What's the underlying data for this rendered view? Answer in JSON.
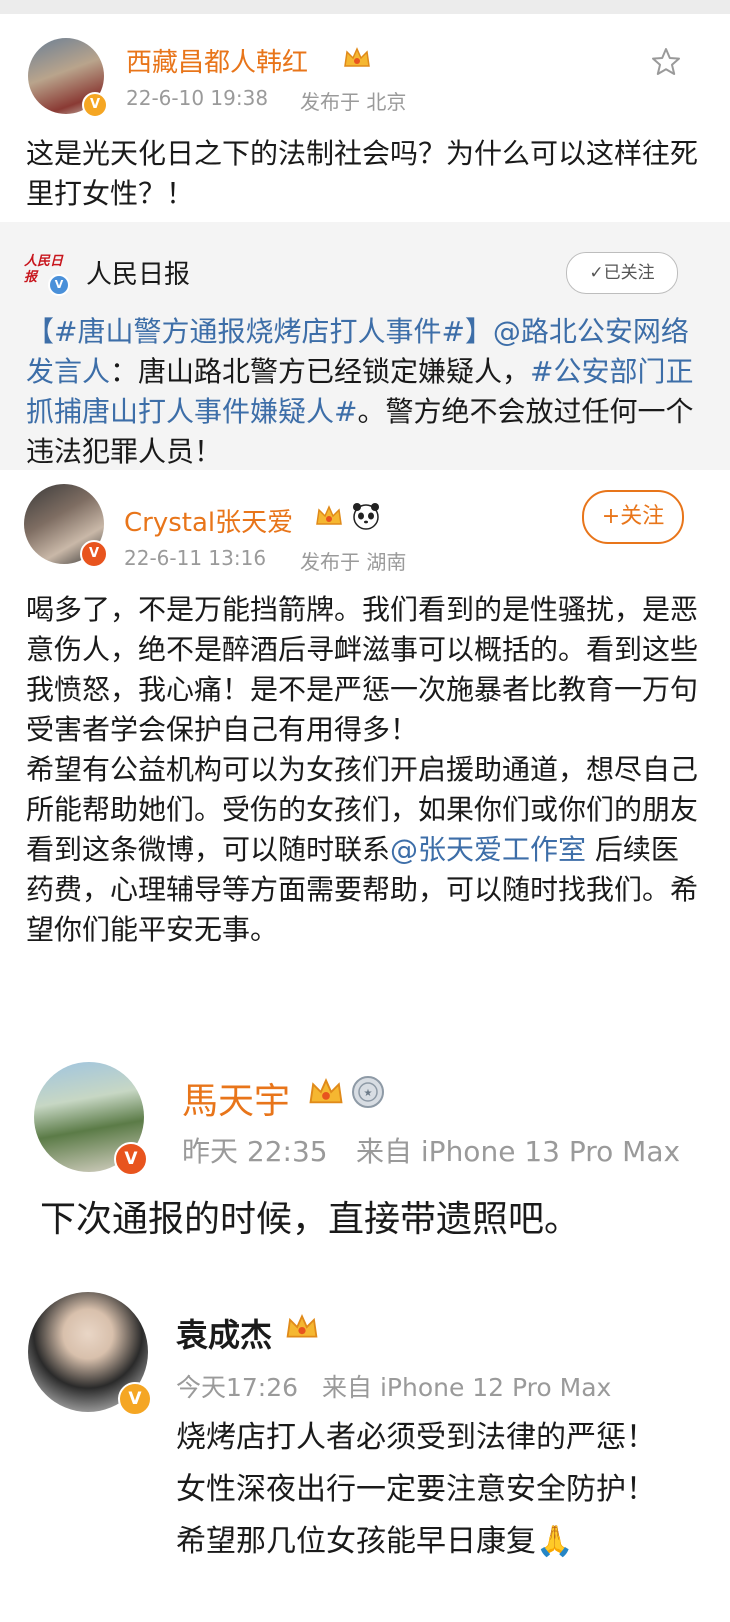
{
  "post1": {
    "author": "西藏昌都人韩红",
    "time": "22-6-10 19:38",
    "location": "发布于 北京",
    "text": "这是光天化日之下的法制社会吗？为什么可以这样往死里打女性？！",
    "badge_color": "#f5a623"
  },
  "repost": {
    "source_name": "人民日报",
    "followed_label": "✓已关注",
    "text_parts": [
      {
        "t": "【#唐山警方通报烧烤店打人事件#】@路北公安网络发言人",
        "link": true
      },
      {
        "t": "：唐山路北警方已经锁定嫌疑人，",
        "link": false
      },
      {
        "t": "#公安部门正抓捕唐山打人事件嫌疑人#",
        "link": true
      },
      {
        "t": "。警方绝不会放过任何一个违法犯罪人员！",
        "link": false
      }
    ]
  },
  "post2": {
    "author": "Crystal张天爱",
    "time": "22-6-11 13:16",
    "location": "发布于 湖南",
    "follow_label": "+关注",
    "text_parts": [
      {
        "t": "喝多了，不是万能挡箭牌。我们看到的是性骚扰，是恶意伤人，绝不是醉酒后寻衅滋事可以概括的。看到这些我愤怒，我心痛！是不是严惩一次施暴者比教育一万句受害者学会保护自己有用得多！\n希望有公益机构可以为女孩们开启援助通道，想尽自己所能帮助她们。受伤的女孩们，如果你们或你们的朋友看到这条微博，可以随时联系",
        "link": false
      },
      {
        "t": "@张天爱工作室",
        "link": true
      },
      {
        "t": " 后续医药费，心理辅导等方面需要帮助，可以随时找我们。希望你们能平安无事。",
        "link": false
      }
    ]
  },
  "post3": {
    "author": "馬天宇",
    "time": "昨天 22:35",
    "source": "来自 iPhone 13 Pro Max",
    "text": "下次通报的时候，直接带遗照吧。"
  },
  "post4": {
    "author": "袁成杰",
    "time": "今天17:26",
    "source": "来自 iPhone 12 Pro Max",
    "text": "烧烤店打人者必须受到法律的严惩！\n女性深夜出行一定要注意安全防护！\n希望那几位女孩能早日康复",
    "emoji": "🙏"
  },
  "colors": {
    "name_orange": "#e8751a",
    "link_blue": "#3d6ea8",
    "meta_gray": "#9a9a9a",
    "repost_bg": "#f4f4f4"
  },
  "icons": [
    "star-icon",
    "crown-icon",
    "panda-icon",
    "medal-icon",
    "verified-icon",
    "pray-emoji"
  ]
}
